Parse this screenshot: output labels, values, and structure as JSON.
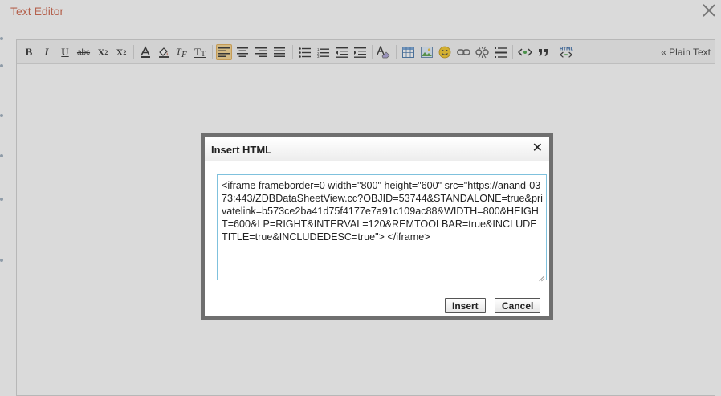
{
  "window": {
    "title": "Text Editor"
  },
  "toolbar": {
    "bold": "B",
    "italic": "I",
    "underline": "U",
    "strikethrough": "abc",
    "subscript": "X",
    "subscript_mark": "2",
    "superscript": "X",
    "superscript_mark": "2",
    "plain_text": "« Plain Text"
  },
  "dialog": {
    "title": "Insert HTML",
    "close_label": "✕",
    "html_value": "<iframe frameborder=0 width=\"800\" height=\"600\" src=\"https://anand-0373:443/ZDBDataSheetView.cc?OBJID=53744&STANDALONE=true&privatelink=b573ce2ba41d75f4177e7a91c109ac88&WIDTH=800&HEIGHT=600&LP=RIGHT&INTERVAL=120&REMTOOLBAR=true&INCLUDETITLE=true&INCLUDEDESC=true\"> </iframe>",
    "insert_label": "Insert",
    "cancel_label": "Cancel"
  },
  "colors": {
    "title_accent": "#cc5a3e",
    "active_button": "#f6d38a",
    "textarea_border": "#7fc1dd"
  }
}
